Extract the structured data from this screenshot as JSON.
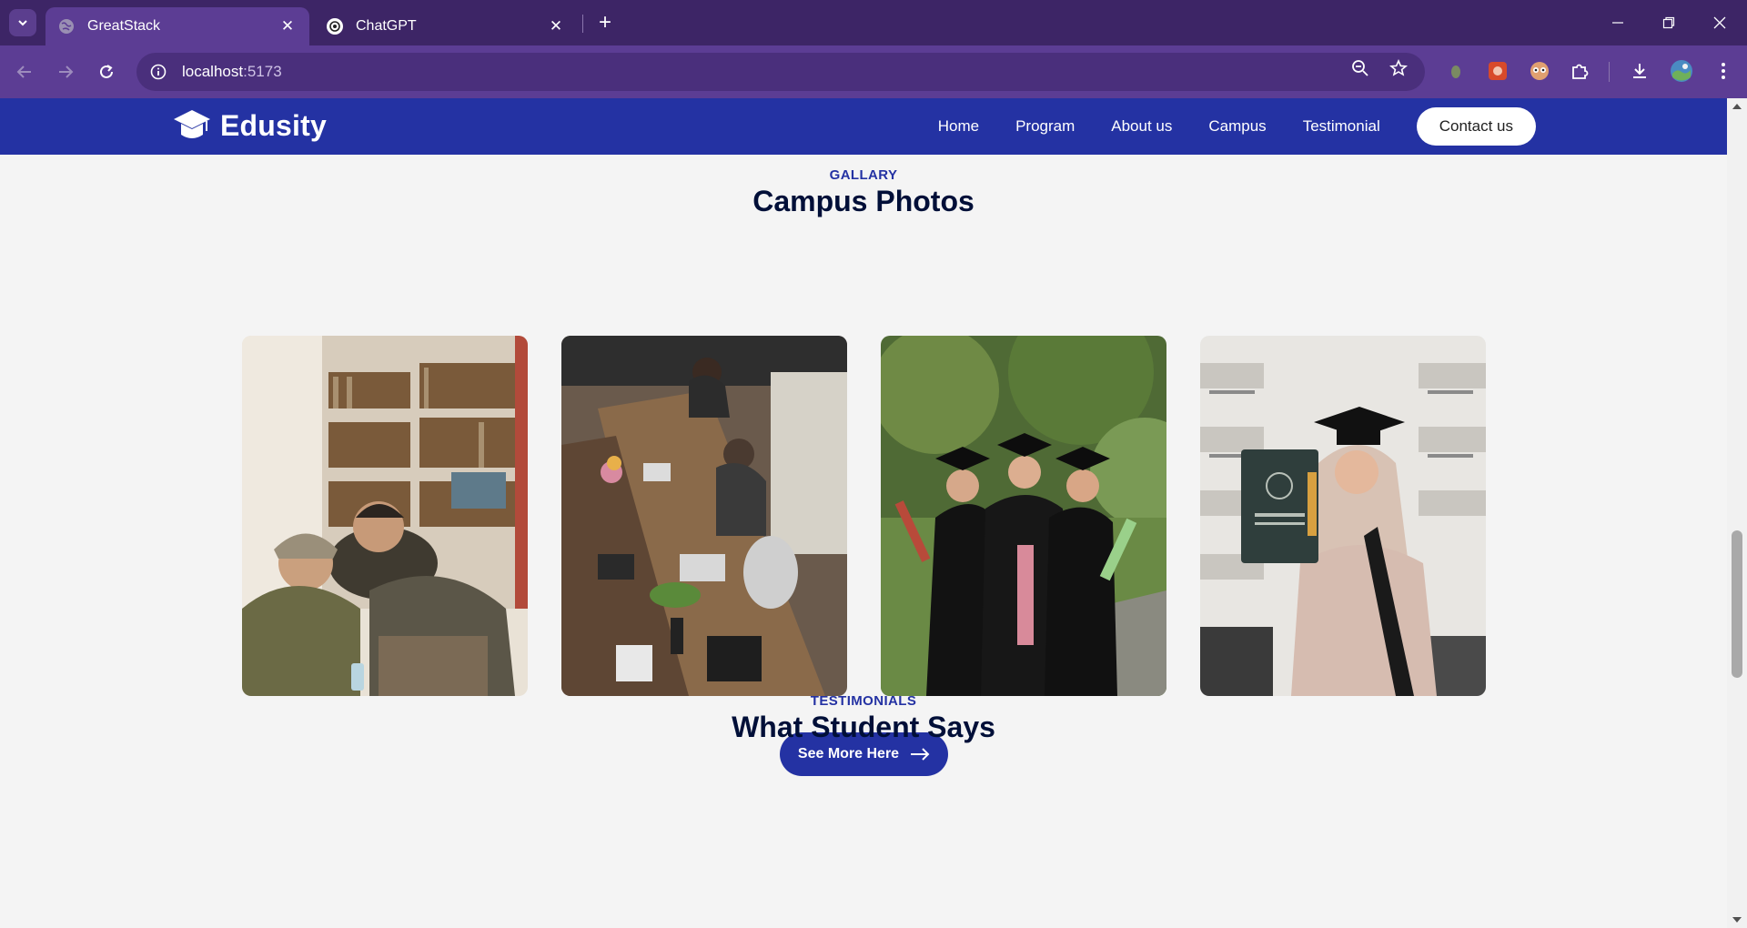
{
  "browser": {
    "tabs": [
      {
        "title": "GreatStack",
        "active": true
      },
      {
        "title": "ChatGPT",
        "active": false
      }
    ],
    "url_host": "localhost",
    "url_port": ":5173"
  },
  "site": {
    "logo_text": "Edusity",
    "nav": [
      "Home",
      "Program",
      "About us",
      "Campus",
      "Testimonial"
    ],
    "contact_label": "Contact us"
  },
  "gallery": {
    "subtitle": "GALLARY",
    "title": "Campus Photos",
    "photos": [
      "students-laughing-at-laptop",
      "coworkers-at-long-table",
      "three-graduates-in-gowns",
      "graduate-holding-diploma"
    ],
    "button_label": "See More Here"
  },
  "testimonials": {
    "subtitle": "TESTIMONIALS",
    "title": "What Student Says"
  },
  "colors": {
    "brand": "#2432a3",
    "heading": "#000f38",
    "page_bg": "#f4f4f4",
    "chrome_dark": "#3d2566",
    "chrome": "#5c3d94"
  }
}
